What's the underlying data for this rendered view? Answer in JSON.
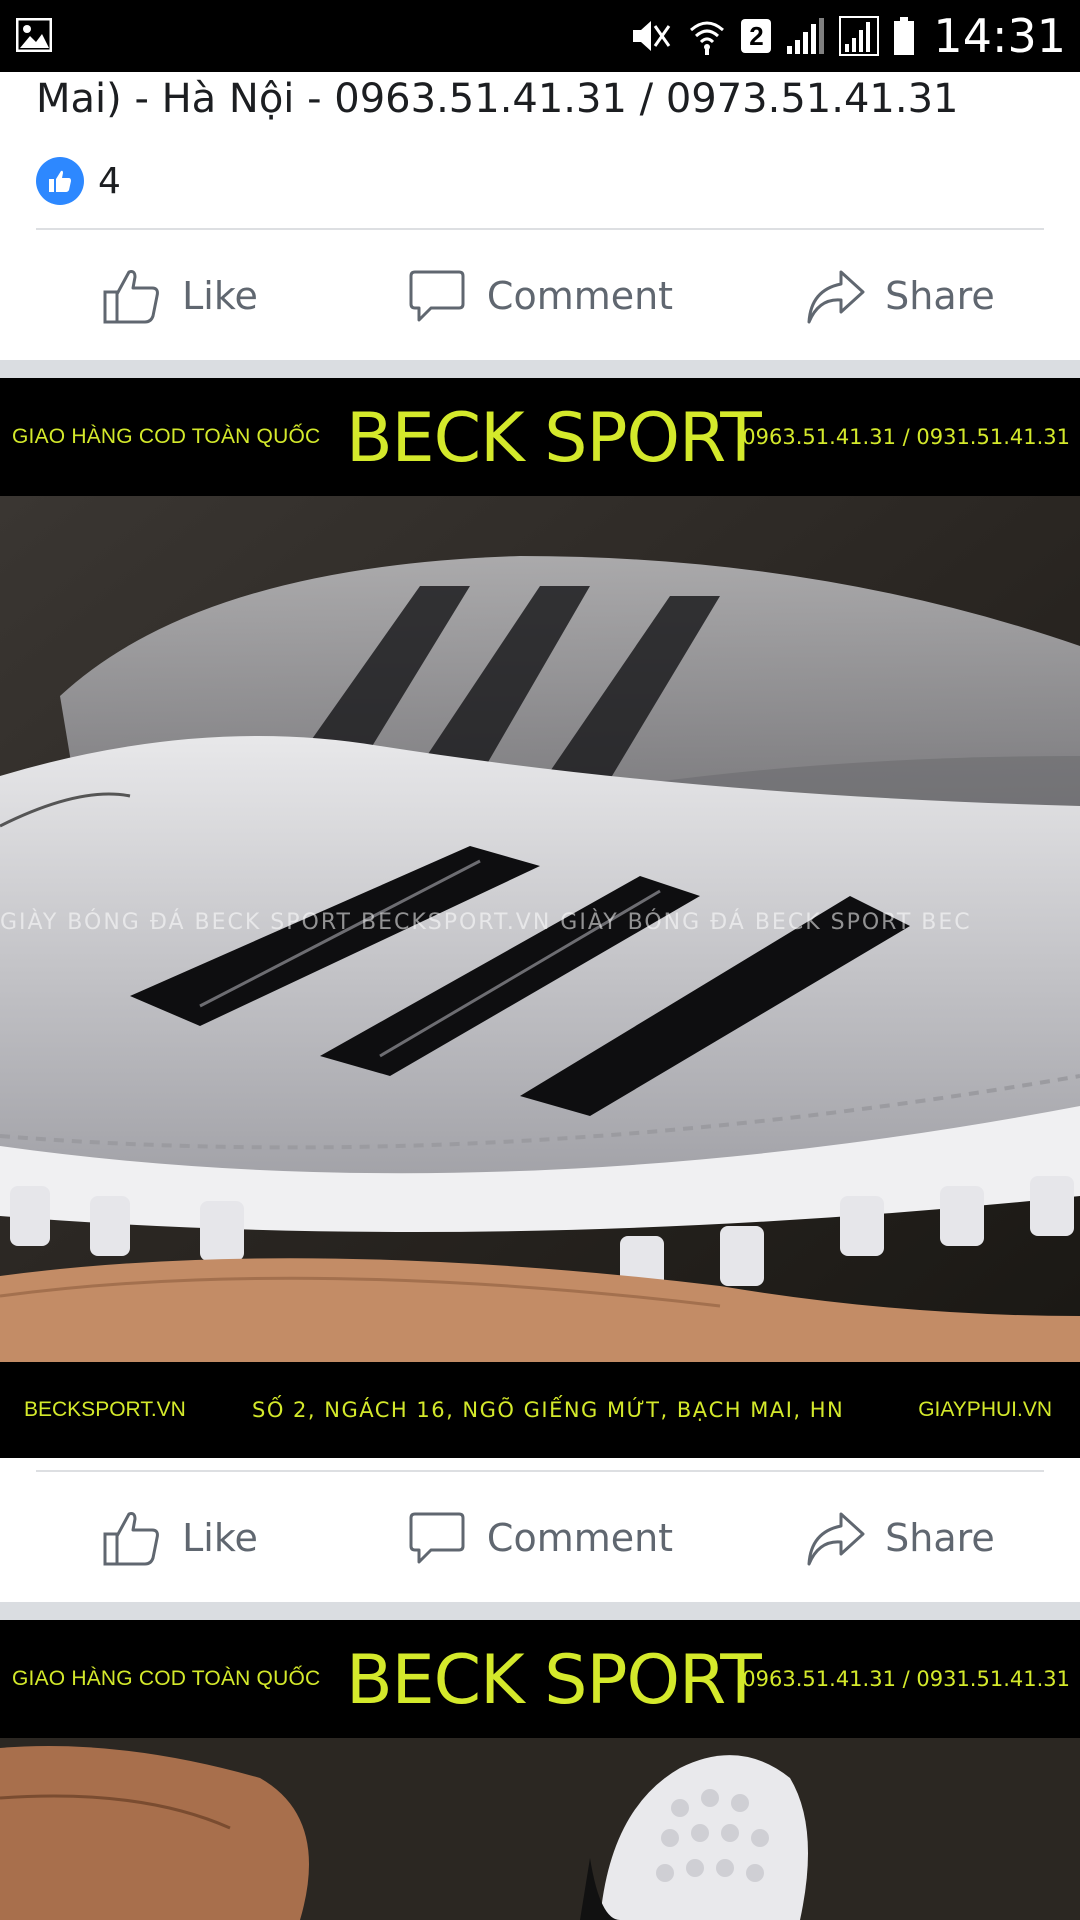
{
  "status_bar": {
    "time": "14:31",
    "sim_badge": "2",
    "icons": [
      "gallery-icon",
      "mute-icon",
      "wifi-icon",
      "signal-icon",
      "signal-icon",
      "battery-icon"
    ]
  },
  "post": {
    "text_line": "Mai) - Hà Nội - 0963.51.41.31 / 0973.51.41.31",
    "reaction_count": "4"
  },
  "actions": {
    "like": "Like",
    "comment": "Comment",
    "share": "Share"
  },
  "banner": {
    "top_left": "GIAO HÀNG COD TOÀN QUỐC",
    "brand": "BECK SPORT",
    "top_right": "0963.51.41.31 / 0931.51.41.31",
    "bottom_left": "BECKSPORT.VN",
    "bottom_center": "SỐ 2, NGÁCH 16, NGÕ GIẾNG MỨT, BẠCH MAI, HN",
    "bottom_right": "GIAYPHUI.VN",
    "watermark": "GIÀY BÓNG ĐÁ BECK SPORT     BECKSPORT.VN     GIÀY BÓNG ĐÁ BECK SPORT     BEC",
    "accent_color": "#d4e92b"
  },
  "colors": {
    "facebook_blue": "#2d88ff",
    "action_grey": "#606770",
    "separator": "#dadde1"
  }
}
